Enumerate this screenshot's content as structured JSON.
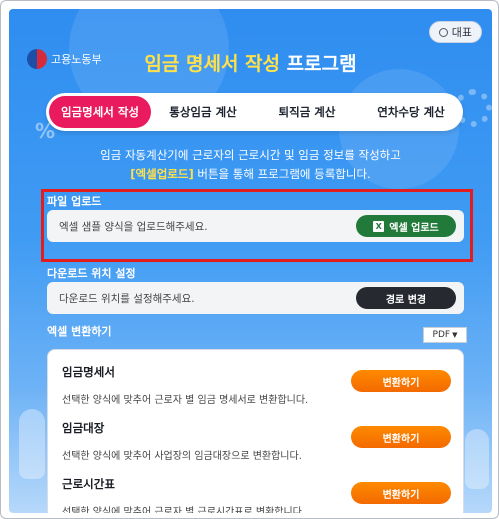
{
  "top_button": {
    "label": "대표"
  },
  "logo": {
    "org_name": "고용노동부"
  },
  "title": {
    "part1": "임금 명세서 작성",
    "part2": "프로그램"
  },
  "tabs": [
    {
      "label": "임금명세서 작성",
      "active": true
    },
    {
      "label": "통상임금 계산",
      "active": false
    },
    {
      "label": "퇴직금 계산",
      "active": false
    },
    {
      "label": "연차수당 계산",
      "active": false
    }
  ],
  "intro": {
    "line1": "임금 자동계산기에 근로자의 근로시간 및 임금 정보를 작성하고",
    "highlight": "[엑셀업로드]",
    "line2_rest": " 버튼을 통해 프로그램에 등록합니다."
  },
  "upload": {
    "section_label": "파일 업로드",
    "placeholder": "엑셀 샘플 양식을 업로드해주세요.",
    "button_label": "엑셀 업로드",
    "button_icon": "excel-icon"
  },
  "download": {
    "section_label": "다운로드 위치 설정",
    "placeholder": "다운로드 위치를 설정해주세요.",
    "button_label": "경로 변경"
  },
  "convert": {
    "section_label": "엑셀 변환하기",
    "format_selected": "PDF",
    "items": [
      {
        "title": "임금명세서",
        "desc": "선택한 양식에 맞추어 근로자 별 임금 명세서로 변환합니다.",
        "button": "변환하기"
      },
      {
        "title": "임금대장",
        "desc": "선택한 양식에 맞추어 사업장의 임금대장으로 변환합니다.",
        "button": "변환하기"
      },
      {
        "title": "근로시간표",
        "desc": "선택한 양식에 맞추어 근로자 별 근로시간표로 변환합니다.",
        "button": "변환하기"
      }
    ]
  },
  "colors": {
    "accent_pink": "#e91a5e",
    "title_yellow": "#ffe14a",
    "upload_green": "#227a3a",
    "convert_orange": "#f36a00",
    "highlight_red": "#e11d1d"
  }
}
